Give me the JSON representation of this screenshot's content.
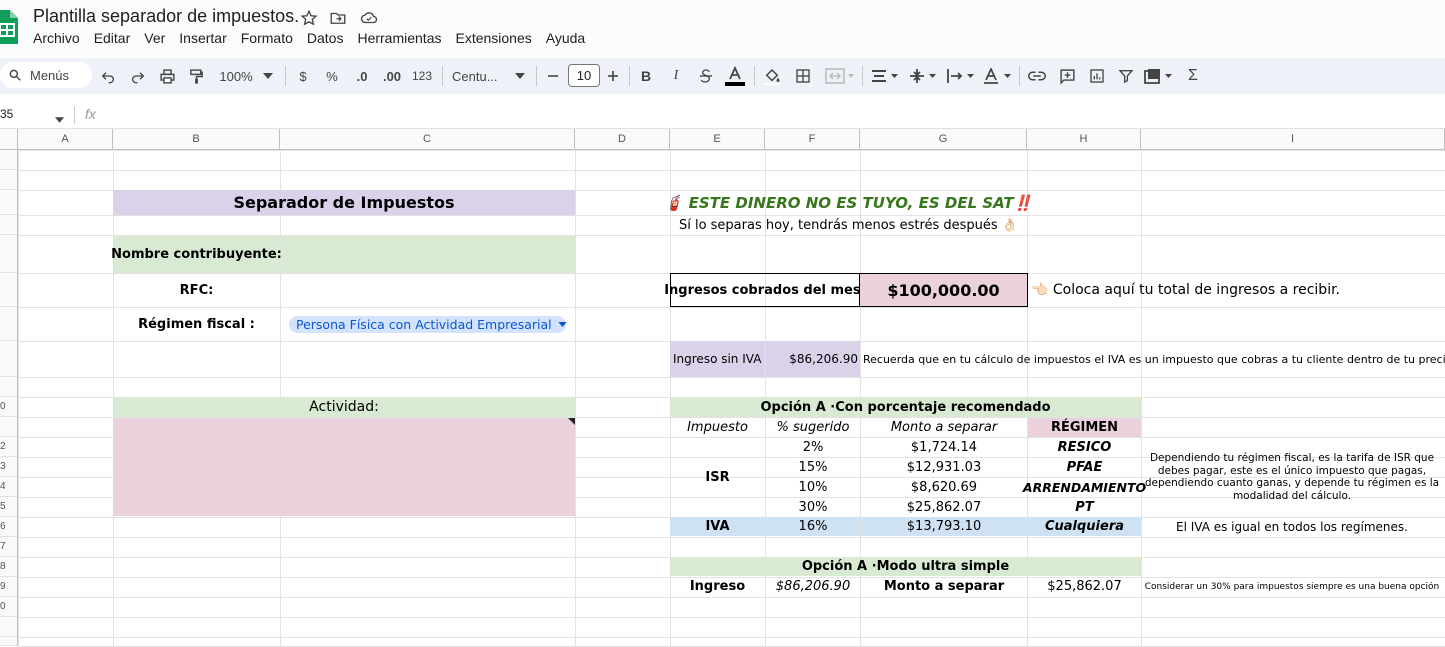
{
  "app": {
    "doc_title": "Plantilla separador de impuestos.",
    "menu": [
      "Archivo",
      "Editar",
      "Ver",
      "Insertar",
      "Formato",
      "Datos",
      "Herramientas",
      "Extensiones",
      "Ayuda"
    ]
  },
  "toolbar": {
    "menus_label": "Menús",
    "zoom": "100%",
    "currency": "$",
    "percent": "%",
    "dec_decrease": ".0",
    "dec_increase": ".00",
    "number_format": "123",
    "font": "Centu...",
    "font_size": "10",
    "bold": "B",
    "italic": "I",
    "sigma": "Σ"
  },
  "formula_bar": {
    "name_box": "35",
    "fx": "fx"
  },
  "columns": [
    "A",
    "B",
    "C",
    "D",
    "E",
    "F",
    "G",
    "H",
    "I"
  ],
  "row_numbers": [
    "",
    "",
    "",
    "",
    "",
    "",
    "",
    "",
    "",
    "0",
    "",
    "2",
    "3",
    "4",
    "5",
    "6",
    "7",
    "8",
    "9",
    "0",
    "",
    ""
  ],
  "sheet": {
    "title": "Separador de Impuestos",
    "nombre_label": "Nombre contribuyente:",
    "rfc_label": "RFC:",
    "regimen_label": "Régimen fiscal :",
    "regimen_value": "Persona Física con Actividad Empresarial",
    "actividad_label": "Actividad:",
    "warning": "🧯 ESTE DINERO NO ES TUYO, ES DEL SAT‼️",
    "warning_sub": "Sí lo separas hoy, tendrás menos estrés después 👌🏻",
    "ingresos_label": "Ingresos cobrados del mes:",
    "ingresos_value": "$100,000.00",
    "ingresos_hint": "👈🏻 Coloca aquí tu total de ingresos a recibir.",
    "sin_iva_label": "Ingreso sin IVA",
    "sin_iva_value": "$86,206.90",
    "sin_iva_note": "Recuerda que en tu cálculo de impuestos el IVA es un impuesto que cobras a tu cliente dentro de tu precio final",
    "opcion_a_title": "Opción A  ·Con porcentaje recomendado",
    "col_impuesto": "Impuesto",
    "col_sugerido": "% sugerido",
    "col_monto": "Monto a separar",
    "col_regimen": "RÉGIMEN",
    "isr_label": "ISR",
    "isr_rows": [
      {
        "pct": "2%",
        "monto": "$1,724.14",
        "regimen": "RESICO"
      },
      {
        "pct": "15%",
        "monto": "$12,931.03",
        "regimen": "PFAE"
      },
      {
        "pct": "10%",
        "monto": "$8,620.69",
        "regimen": "ARRENDAMIENTO"
      },
      {
        "pct": "30%",
        "monto": "$25,862.07",
        "regimen": "PT"
      }
    ],
    "isr_note": "Dependiendo tu régimen fiscal, es la tarifa de ISR que debes pagar, este es el único impuesto que pagas, dependiendo cuanto ganas, y depende tu régimen es la modalidad del cálculo.",
    "iva_label": "IVA",
    "iva_pct": "16%",
    "iva_monto": "$13,793.10",
    "iva_regimen": "Cualquiera",
    "iva_note": "El IVA es igual en todos los regímenes.",
    "simple_title": "Opción A  ·Modo ultra simple",
    "simple_ingreso_label": "Ingreso",
    "simple_ingreso_value": "$86,206.90",
    "simple_monto_label": "Monto a separar",
    "simple_monto_value": "$25,862.07",
    "simple_note": "Considerar un 30% para impuestos siempre es una buena opción"
  },
  "colors": {
    "lavender": "#d9d2e9",
    "green": "#d9ead3",
    "pink": "#ead1dc",
    "blue": "#cfe2f3",
    "warning_green": "#38761d",
    "chip": "#d3e3fd"
  }
}
